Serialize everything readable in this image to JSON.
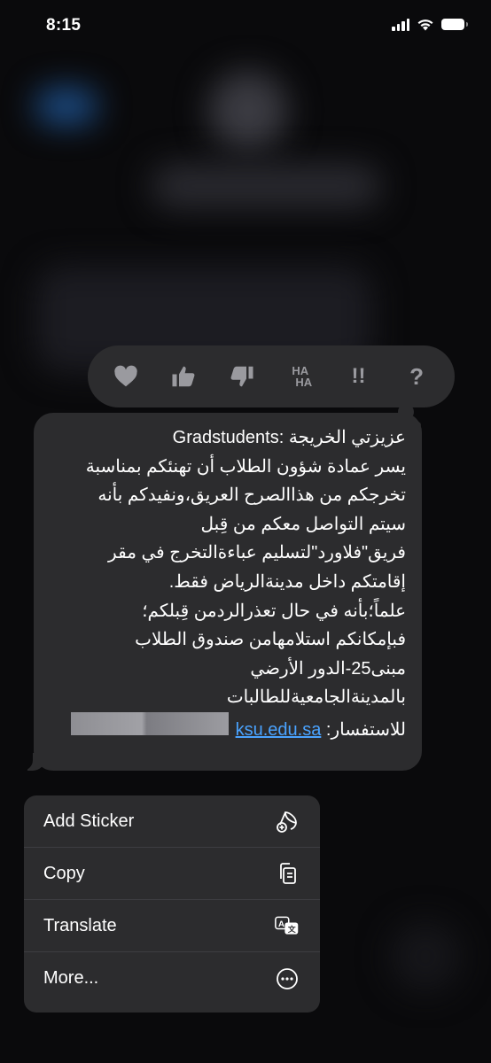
{
  "status_bar": {
    "time": "8:15"
  },
  "reactions": [
    {
      "icon": "heart-icon"
    },
    {
      "icon": "thumbs-up-icon"
    },
    {
      "icon": "thumbs-down-icon"
    },
    {
      "icon": "haha-icon",
      "label_top": "HA",
      "label_bottom": "HA"
    },
    {
      "icon": "exclamation-icon",
      "label": "!!"
    },
    {
      "icon": "question-icon",
      "label": "?"
    }
  ],
  "message": {
    "lines": [
      "عزيزتي الخريجة :Gradstudents",
      "يسر عمادة شؤون الطلاب أن تهنئكم بمناسبة",
      "تخرجكم من هذاالصرح العريق،ونفيدكم بأنه",
      "سيتم التواصل معكم من قِبل",
      "فريق\"فلاورد\"لتسليم عباءةالتخرج في مقر",
      "إقامتكم داخل مدينةالرياض فقط.",
      "علماً؛بأنه في حال تعذرالردمن قِبلكم؛",
      "فبإمكانكم استلامهامن صندوق الطلاب",
      "مبنى25-الدور الأرضي",
      "بالمدينةالجامعيةللطالبات"
    ],
    "inquiry_label": "للاستفسار:",
    "link_text": "ksu.edu.sa",
    "link_color": "#4aa3ff"
  },
  "menu": {
    "items": [
      {
        "label": "Add Sticker",
        "icon": "add-sticker-icon"
      },
      {
        "label": "Copy",
        "icon": "copy-icon"
      },
      {
        "label": "Translate",
        "icon": "translate-icon"
      },
      {
        "label": "More...",
        "icon": "more-icon"
      }
    ]
  },
  "colors": {
    "background": "#0a0a0c",
    "bubble": "#2c2c2e",
    "reaction_icon": "#9a9a9f"
  }
}
